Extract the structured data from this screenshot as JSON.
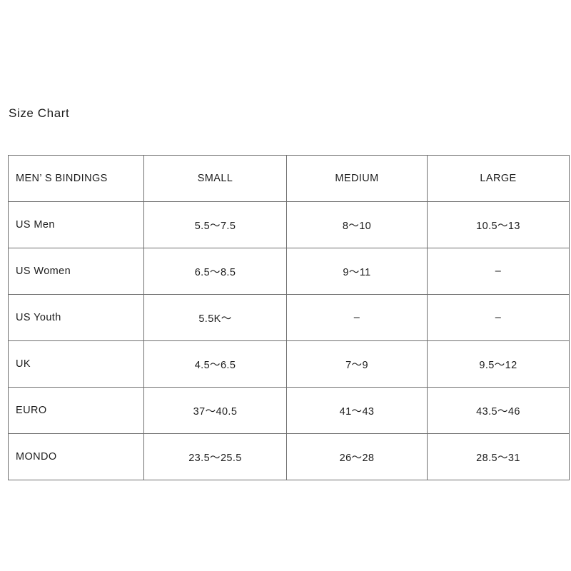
{
  "title": "Size Chart",
  "table": {
    "headers": [
      "MEN’ S BINDINGS",
      "SMALL",
      "MEDIUM",
      "LARGE"
    ],
    "rows": [
      {
        "label": "US Men",
        "small": "5.5～7.5",
        "medium": "8～10",
        "large": "10.5～13"
      },
      {
        "label": "US Women",
        "small": "6.5～8.5",
        "medium": "9～11",
        "large": "–"
      },
      {
        "label": "US Youth",
        "small": "5.5K～",
        "medium": "–",
        "large": "–"
      },
      {
        "label": "UK",
        "small": "4.5～6.5",
        "medium": "7～9",
        "large": "9.5～12"
      },
      {
        "label": "EURO",
        "small": "37～40.5",
        "medium": "41～43",
        "large": "43.5～46"
      },
      {
        "label": "MONDO",
        "small": "23.5～25.5",
        "medium": "26～28",
        "large": "28.5～31"
      }
    ]
  },
  "colors": {
    "text": "#1c1c1c",
    "border": "#6e6e6e",
    "background": "#ffffff"
  }
}
